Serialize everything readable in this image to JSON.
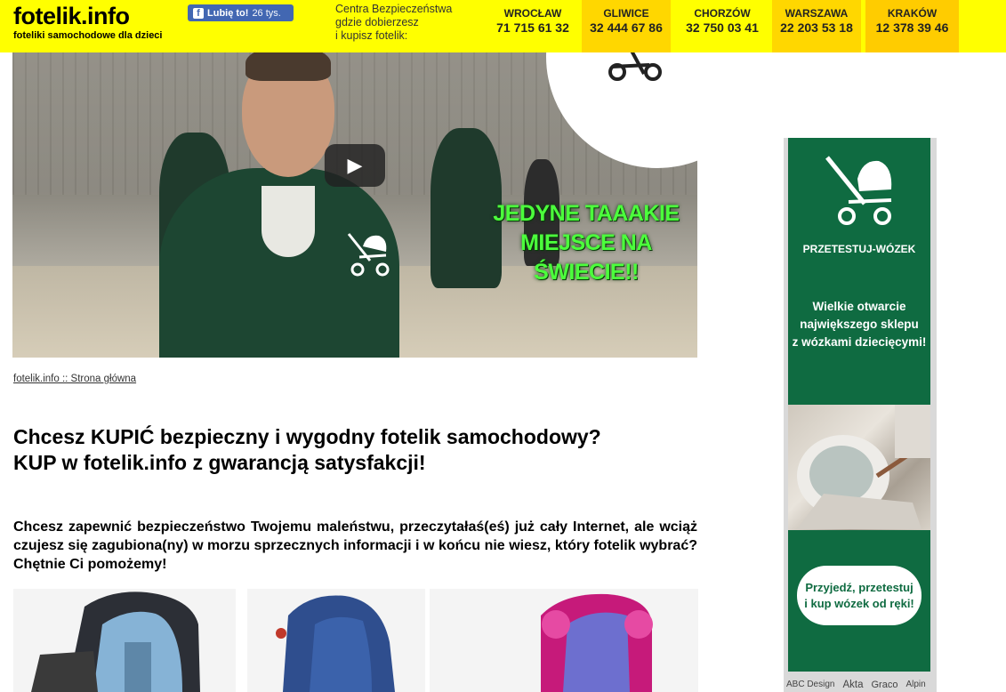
{
  "header": {
    "logo": "fotelik.info",
    "tagline": "foteliki samochodowe dla dzieci",
    "fb_like_label": "Lubię to!",
    "fb_like_count": "26 tys.",
    "centers_line1": "Centra Bezpieczeństwa",
    "centers_line2": "gdzie dobierzesz",
    "centers_line3": "i kupisz fotelik:",
    "cities": [
      {
        "name": "WROCŁAW",
        "phone": "71 715 61 32"
      },
      {
        "name": "GLIWICE",
        "phone": "32 444 67 86"
      },
      {
        "name": "CHORZÓW",
        "phone": "32 750 03 41"
      },
      {
        "name": "WARSZAWA",
        "phone": "22 203 53 18"
      },
      {
        "name": "KRAKÓW",
        "phone": "12 378 39 46"
      }
    ]
  },
  "video": {
    "slogan_line1": "JEDYNE TAAAKIE",
    "slogan_line2": "MIEJSCE NA",
    "slogan_line3": "ŚWIECIE!!",
    "play_icon": "▶"
  },
  "breadcrumb": "fotelik.info :: Strona główna",
  "heading": {
    "line1": "Chcesz KUPIĆ bezpieczny i wygodny fotelik samochodowy?",
    "line2": "KUP w fotelik.info z gwarancją satysfakcji!"
  },
  "intro": "Chcesz zapewnić bezpieczeństwo Twojemu maleństwu, przeczytałaś(eś) już cały Internet, ale wciąż czujesz się zagubiona(ny) w morzu sprzecznych informacji i w końcu nie wiesz, który fotelik wybrać? Chętnie Ci pomożemy!",
  "ad": {
    "title": "PRZETESTUJ-WÓZEK",
    "text_line1": "Wielkie otwarcie",
    "text_line2": "największego sklepu",
    "text_line3": "z wózkami dziecięcymi!",
    "cta_line1": "Przyjedź, przetestuj",
    "cta_line2": "i kup wózek od ręki!"
  },
  "brands": [
    "ABC Design",
    "Akta",
    "Graco",
    "Alpin"
  ],
  "colors": {
    "topbar": "#ffff00",
    "ad_green": "#0f6b41",
    "slogan_green": "#4cff3c",
    "fb_blue": "#4267b2"
  }
}
